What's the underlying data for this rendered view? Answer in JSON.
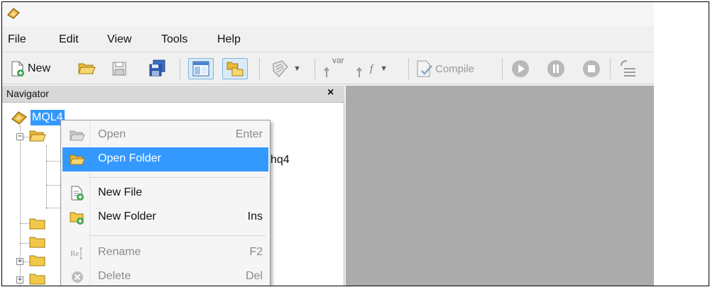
{
  "menu": {
    "file": "File",
    "edit": "Edit",
    "view": "View",
    "tools": "Tools",
    "help": "Help"
  },
  "toolbar": {
    "new_label": "New",
    "var_label": "var",
    "func_label": "f",
    "compile_label": "Compile"
  },
  "navigator": {
    "title": "Navigator",
    "close_glyph": "×",
    "root_label": "MQL4",
    "partial_item_label": "hq4"
  },
  "context_menu": {
    "items": [
      {
        "label": "Open",
        "shortcut": "Enter"
      },
      {
        "label": "Open Folder",
        "shortcut": ""
      },
      {
        "label": "New File",
        "shortcut": ""
      },
      {
        "label": "New Folder",
        "shortcut": "Ins"
      },
      {
        "label": "Rename",
        "shortcut": "F2"
      },
      {
        "label": "Delete",
        "shortcut": "Del"
      }
    ]
  },
  "colors": {
    "selection": "#3399ff",
    "editor_bg": "#ababab",
    "folder_yellow": "#f5c542"
  }
}
